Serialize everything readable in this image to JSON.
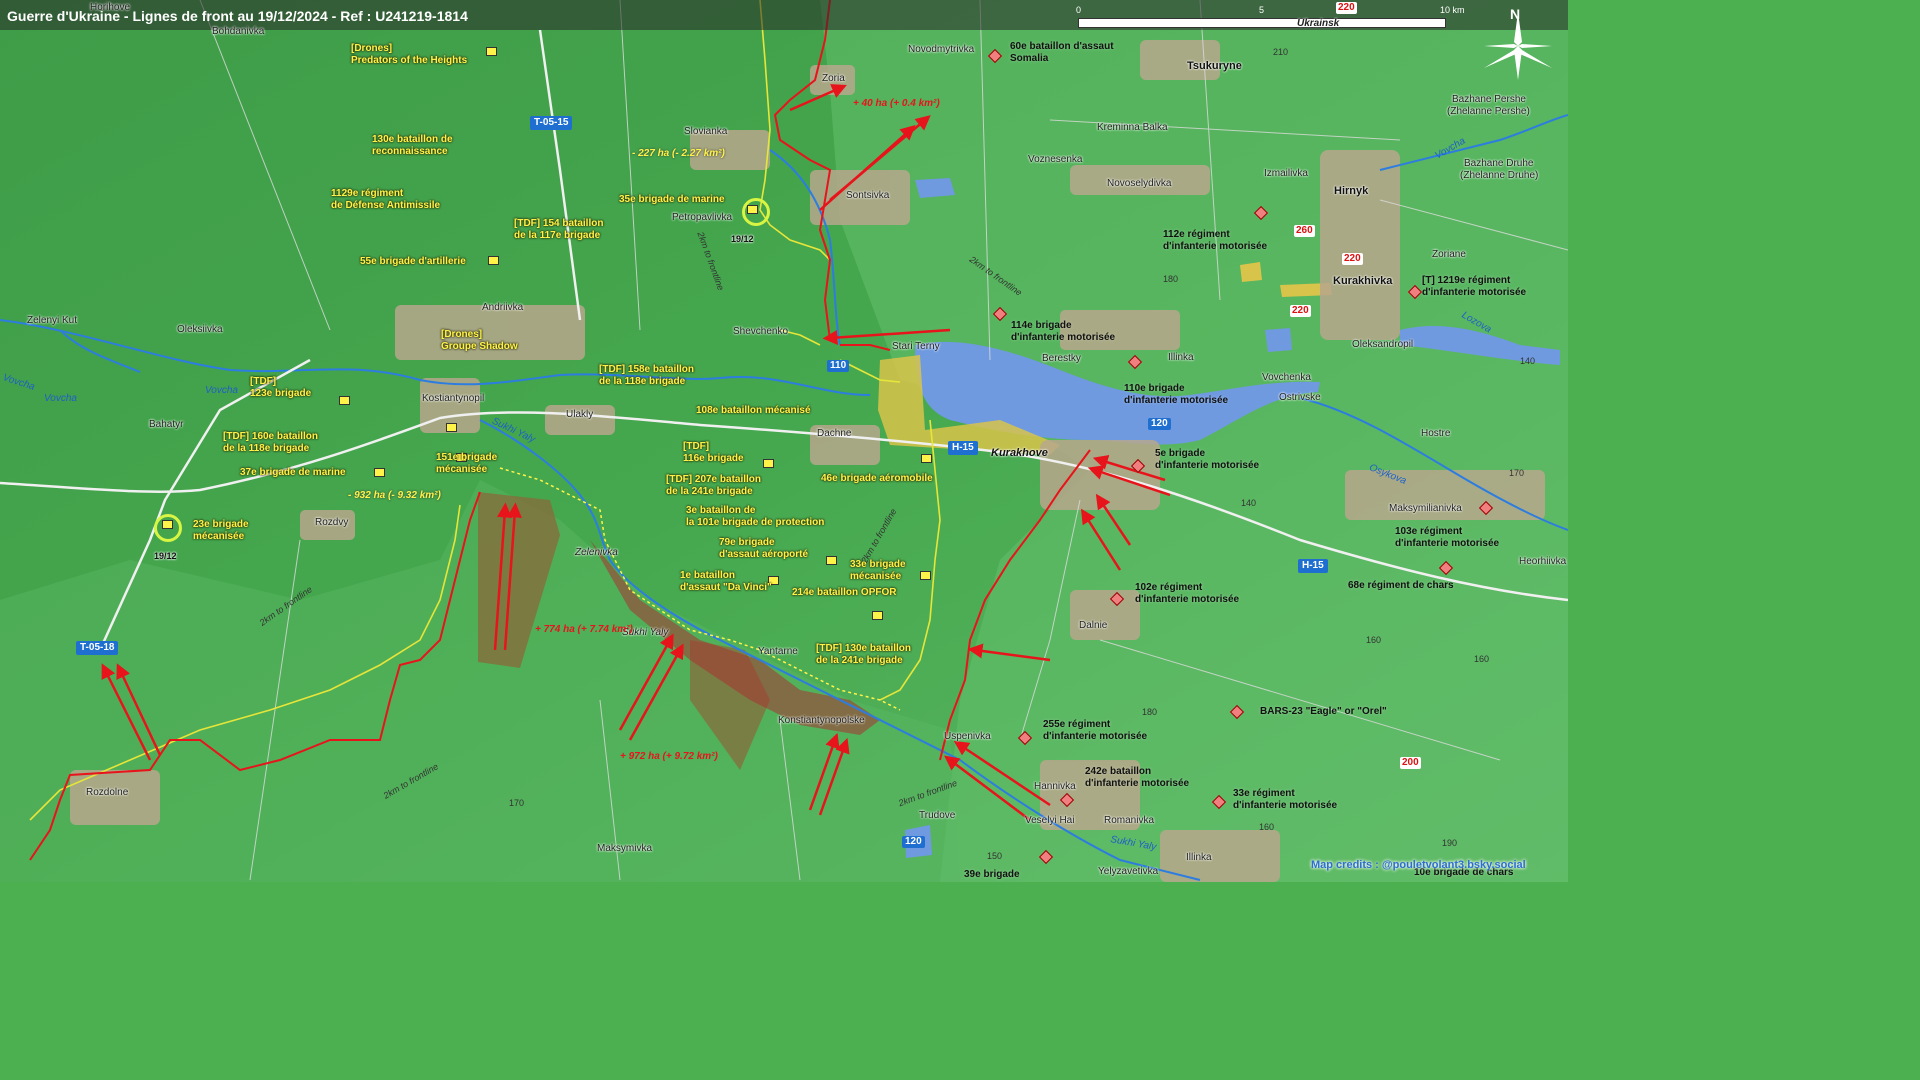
{
  "header": {
    "title": "Guerre d'Ukraine - Lignes de front au 19/12/2024 - Ref : U241219-1814"
  },
  "scale": {
    "l0": "0",
    "l5": "5",
    "l10": "10 km",
    "region": "Ukrainsk"
  },
  "compass": {
    "north": "N"
  },
  "credit": "Map credits : @pouletvolant3.bsky.social",
  "towns": {
    "bohdanivka": "Bohdanivka",
    "horihove": "Horihove",
    "zoria": "Zoria",
    "slovianka": "Slovianka",
    "petropavlivka": "Petropavlivka",
    "sontsivka": "Sontsivka",
    "novodmytrivka": "Novodmytrivka",
    "tsukuryne": "Tsukuryne",
    "kreminna_balka": "Kreminna Balka",
    "voznesenka": "Voznesenka",
    "novoselydivka": "Novoselydivka",
    "izmailivka": "Izmailivka",
    "hirnyk": "Hirnyk",
    "zoriane": "Zoriane",
    "kurakhivka": "Kurakhivka",
    "bazhane_pershe": "Bazhane Pershe",
    "bazhane_pershe2": "(Zhelanne Pershe)",
    "bazhane_druhe": "Bazhane Druhe",
    "bazhane_druhe2": "(Zhelanne Druhe)",
    "andriivka": "Andriivka",
    "zelenyi_kut": "Zelenyi Kut",
    "oleksiivka": "Oleksiivka",
    "shevchenko": "Shevchenko",
    "stari_terny": "Stari Terny",
    "berestky": "Berestky",
    "illinka": "Illinka",
    "oleksandropil": "Oleksandropil",
    "vovchenka": "Vovchenka",
    "ostrivske": "Ostrivske",
    "kostiantynopil": "Kostiantynopil",
    "bahatyr": "Bahatyr",
    "ulakly": "Ulakly",
    "dachne": "Dachne",
    "kurakhove": "Kurakhove",
    "hostre": "Hostre",
    "rozdolne": "Rozdolne",
    "rizdvy": "Rozdvy",
    "zelenivka": "Zelenivka",
    "sukhi_yaly_t": "Sukhi Yaly",
    "yantarne": "Yantarne",
    "konstantynopolske": "Konstiantynopolske",
    "uspenivka": "Uspenivka",
    "dalnie": "Dalnie",
    "maksymilianivka": "Maksymilianivka",
    "heorhiivka": "Heorhiivka",
    "hannivka": "Hannivka",
    "veselyi_hai": "Veselyi Hai",
    "romanivka": "Romanivka",
    "trudove": "Trudove",
    "maksymivka": "Maksymivka",
    "illinka2": "Illinka",
    "yelyzavetivka": "Yelyzavetivka"
  },
  "rivers": {
    "vovcha1": "Vovcha",
    "vovcha2": "Vovcha",
    "vovcha3": "Vovcha",
    "vovcha4": "Vovcha",
    "sukhi_yaly1": "Sukhi Yaly",
    "sukhi_yaly2": "Sukhi Yaly",
    "osykova": "Osykova",
    "lozova": "Lozova"
  },
  "roads": {
    "t0515": "T-05-15",
    "t0518": "T-05-18",
    "h15a": "H-15",
    "h15b": "H-15",
    "r110": "110",
    "r120": "120",
    "r120b": "120"
  },
  "road_nums_red": {
    "r220a": "220",
    "r220b": "220",
    "r220c": "220",
    "r260": "260",
    "r200": "200"
  },
  "elevations": {
    "e210": "210",
    "e180": "180",
    "e140": "140",
    "e170a": "170",
    "e140b": "140",
    "e160a": "160",
    "e160b": "160",
    "e180b": "180",
    "e170b": "170",
    "e160c": "160",
    "e150": "150",
    "e190": "190"
  },
  "frontline_labels": {
    "f1": "2km to frontline",
    "f2": "2km to frontline",
    "f3": "2km to frontline",
    "f4": "2km to frontline",
    "f5": "2km to frontline",
    "f6": "2km to frontline"
  },
  "changes": {
    "c1": "+ 40 ha (+ 0.4 km²)",
    "c2": "- 227 ha (- 2.27 km²)",
    "c3": "- 932 ha (- 9.32 km²)",
    "c4": "+ 774 ha (+ 7.74 km²)",
    "c5": "+ 972 ha (+ 9.72 km²)"
  },
  "dates": {
    "d1": "19/12",
    "d2": "19/12"
  },
  "ua_units": {
    "u1": "[Drones]\nPredators of the Heights",
    "u2": "130e bataillon de\nreconnaissance",
    "u3": "1129e régiment\nde Défense Antimissile",
    "u4": "[TDF] 154 bataillon\nde la 117e brigade",
    "u5": "55e brigade d'artillerie",
    "u6": "35e brigade de marine",
    "u7": "[Drones]\nGroupe Shadow",
    "u8": "[TDF] 158e bataillon\nde la 118e brigade",
    "u9": "[TDF]\n123e brigade",
    "u10": "[TDF] 160e bataillon\nde la 118e brigade",
    "u11": "37e brigade de marine",
    "u12": "151e brigade\nmécanisée",
    "u13": "23e brigade\nmécanisée",
    "u14": "108e bataillon mécanisé",
    "u15": "[TDF]\n116e brigade",
    "u16": "[TDF] 207e bataillon\nde la 241e brigade",
    "u17": "3e bataillon de\nla 101e brigade de protection",
    "u18": "79e brigade\nd'assaut aéroporté",
    "u19": "1e bataillon\nd'assaut \"Da Vinci\"",
    "u20": "33e brigade\nmécanisée",
    "u21": "214e bataillon OPFOR",
    "u22": "[TDF] 130e bataillon\nde la 241e brigade",
    "u23": "46e brigade aéromobile"
  },
  "ru_units": {
    "r1": "60e bataillon d'assaut\nSomalia",
    "r2": "112e régiment\nd'infanterie motorisée",
    "r3": "[T] 1219e régiment\nd'infanterie motorisée",
    "r4": "114e brigade\nd'infanterie motorisée",
    "r5": "110e brigade\nd'infanterie motorisée",
    "r6": "5e brigade\nd'infanterie motorisée",
    "r7": "103e régiment\nd'infanterie motorisée",
    "r8": "68e régiment de chars",
    "r9": "102e régiment\nd'infanterie motorisée",
    "r10": "BARS-23 \"Eagle\" or \"Orel\"",
    "r11": "255e régiment\nd'infanterie motorisée",
    "r12": "242e bataillon\nd'infanterie motorisée",
    "r13": "33e régiment\nd'infanterie motorisée",
    "r14": "10e brigade de chars",
    "r15": "39e brigade"
  }
}
